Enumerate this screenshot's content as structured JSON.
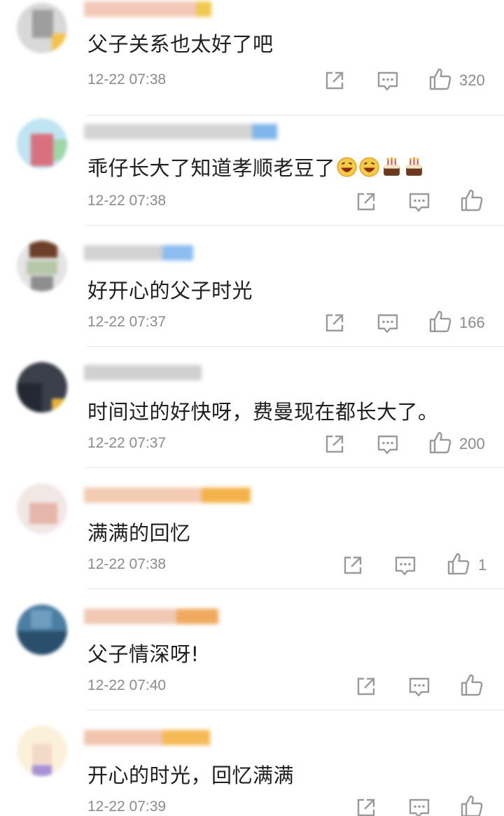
{
  "comments": [
    {
      "text": "父子关系也太好了吧",
      "time": "12-22 07:38",
      "likes": "320"
    },
    {
      "text": "乖仔长大了知道孝顺老豆了",
      "time": "12-22 07:38",
      "likes": "",
      "emojis": [
        "laugh-emoji",
        "laugh-emoji",
        "cake-emoji",
        "cake-emoji"
      ]
    },
    {
      "text": "好开心的父子时光",
      "time": "12-22 07:37",
      "likes": "166"
    },
    {
      "text": "时间过的好快呀，费曼现在都长大了。",
      "time": "12-22 07:37",
      "likes": "200"
    },
    {
      "text": "满满的回忆",
      "time": "12-22 07:38",
      "likes": "1"
    },
    {
      "text": "父子情深呀!",
      "time": "12-22 07:40",
      "likes": ""
    },
    {
      "text": "开心的时光，回忆满满",
      "time": "12-22 07:39",
      "likes": ""
    }
  ],
  "icons": {
    "share": "share-icon",
    "reply": "comment-icon",
    "like": "thumbs-up-icon"
  },
  "colors": {
    "text": "#1f1f1f",
    "meta": "#8b8b8b",
    "divider": "#e6e6e6",
    "icon": "#9a9a9a"
  }
}
